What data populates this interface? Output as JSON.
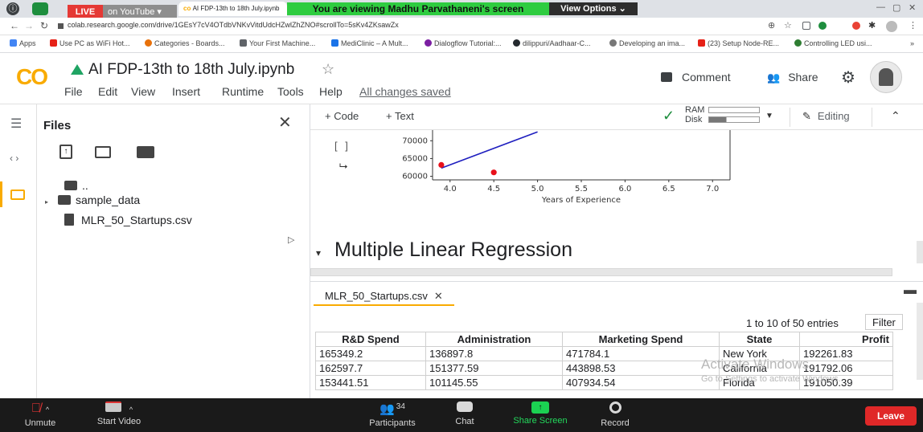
{
  "browser": {
    "live_badge": "LIVE",
    "youtube_label": "on YouTube ▾",
    "tab_title": "AI FDP-13th to 18th July.ipynb",
    "share_banner": "You are viewing Madhu Parvathaneni's screen",
    "view_options": "View Options ⌄",
    "url": "colab.research.google.com/drive/1GEsY7cV4OTdbVNKvVitdUdcHZwlZhZNO#scrollTo=5sKv4ZKsawZx",
    "bookmarks": [
      {
        "label": "Apps",
        "color": "#4285f4"
      },
      {
        "label": "Use PC as WiFi Hot...",
        "color": "#e62117"
      },
      {
        "label": "Categories - Boards...",
        "color": "#e8710a"
      },
      {
        "label": "Your First Machine...",
        "color": "#5f6368"
      },
      {
        "label": "MediClinic – A Mult...",
        "color": "#1a73e8"
      },
      {
        "label": "Dialogflow Tutorial:...",
        "color": "#7b1fa2"
      },
      {
        "label": "dilippuri/Aadhaar-C...",
        "color": "#24292e"
      },
      {
        "label": "Developing an ima...",
        "color": "#777"
      },
      {
        "label": "(23) Setup Node-RE...",
        "color": "#e62117"
      },
      {
        "label": "Controlling LED usi...",
        "color": "#2e7d32"
      }
    ]
  },
  "colab": {
    "logo": "CO",
    "notebook_title": "AI FDP-13th to 18th July.ipynb",
    "menu": [
      "File",
      "Edit",
      "View",
      "Insert",
      "Runtime",
      "Tools",
      "Help"
    ],
    "save_status": "All changes saved",
    "comment_label": "Comment",
    "share_label": "Share"
  },
  "sidebar": {
    "title": "Files",
    "items": [
      {
        "label": ".."
      },
      {
        "label": "sample_data"
      },
      {
        "label": "MLR_50_Startups.csv"
      }
    ]
  },
  "toolbar": {
    "code_label": "+ Code",
    "text_label": "+ Text",
    "ram_label": "RAM",
    "disk_label": "Disk",
    "editing_label": "Editing"
  },
  "cell": {
    "run_brackets": "[ ]"
  },
  "chart_data": {
    "type": "scatter",
    "xlabel": "Years of Experience",
    "ylabel": "",
    "x_ticks": [
      "4.0",
      "4.5",
      "5.0",
      "5.5",
      "6.0",
      "6.5",
      "7.0"
    ],
    "y_ticks": [
      "60000",
      "65000",
      "70000"
    ],
    "xlim": [
      3.8,
      7.2
    ],
    "ylim": [
      59000,
      73000
    ],
    "points": [
      {
        "x": 3.9,
        "y": 63200
      },
      {
        "x": 4.5,
        "y": 61100
      }
    ],
    "line": [
      {
        "x": 3.9,
        "y": 62300
      },
      {
        "x": 5.0,
        "y": 72500
      }
    ],
    "point_color": "#e8101b",
    "line_color": "#1f1fbf"
  },
  "section": {
    "heading": "Multiple Linear Regression"
  },
  "data_table": {
    "tab_label": "MLR_50_Startups.csv",
    "entries_text": "1 to 10 of 50 entries",
    "filter_label": "Filter",
    "columns": [
      "R&D Spend",
      "Administration",
      "Marketing Spend",
      "State",
      "Profit"
    ],
    "rows": [
      [
        "165349.2",
        "136897.8",
        "471784.1",
        "New York",
        "192261.83"
      ],
      [
        "162597.7",
        "151377.59",
        "443898.53",
        "California",
        "191792.06"
      ],
      [
        "153441.51",
        "101145.55",
        "407934.54",
        "Florida",
        "191050.39"
      ]
    ]
  },
  "watermark": {
    "line1": "Activate Windows",
    "line2": "Go to Settings to activate Windows."
  },
  "zoom": {
    "unmute": "Unmute",
    "start_video": "Start Video",
    "participants": "Participants",
    "participants_count": "34",
    "chat": "Chat",
    "share_screen": "Share Screen",
    "record": "Record",
    "leave": "Leave"
  }
}
